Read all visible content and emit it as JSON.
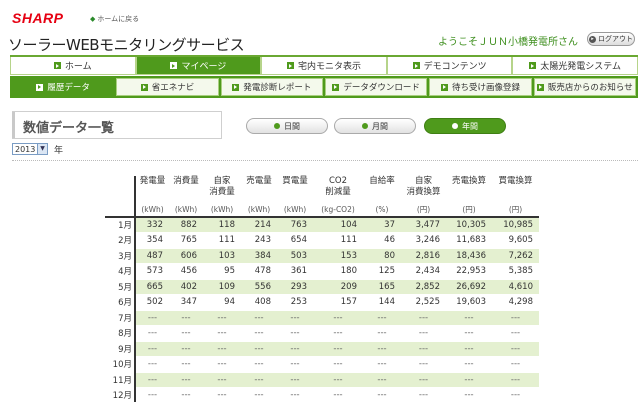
{
  "brand": {
    "logo": "SHARP",
    "home_link": "ホームに戻る"
  },
  "app_title": "ソーラーWEBモニタリングサービス",
  "welcome": "ようこそＪＵＮ小橋発電所さん",
  "logout_label": "ログアウト",
  "nav_main": [
    {
      "label": "ホーム",
      "active": false
    },
    {
      "label": "マイページ",
      "active": true
    },
    {
      "label": "宅内モニタ表示",
      "active": false
    },
    {
      "label": "デモコンテンツ",
      "active": false
    },
    {
      "label": "太陽光発電システム",
      "active": false
    }
  ],
  "nav_sub": [
    {
      "label": "履歴データ",
      "active": true
    },
    {
      "label": "省エネナビ",
      "active": false
    },
    {
      "label": "発電診断レポート",
      "active": false
    },
    {
      "label": "データダウンロード",
      "active": false
    },
    {
      "label": "待ち受け画像登録",
      "active": false
    },
    {
      "label": "販売店からのお知らせ",
      "active": false
    }
  ],
  "section_title": "数値データ一覧",
  "period_tabs": [
    {
      "label": "日間",
      "active": false
    },
    {
      "label": "月間",
      "active": false
    },
    {
      "label": "年間",
      "active": true
    }
  ],
  "year_select": {
    "value": "2013",
    "unit": "年"
  },
  "table": {
    "headers": [
      {
        "label": "発電量",
        "unit": "(kWh)"
      },
      {
        "label": "消費量",
        "unit": "(kWh)"
      },
      {
        "label": "自家\n消費量",
        "unit": "(kWh)"
      },
      {
        "label": "売電量",
        "unit": "(kWh)"
      },
      {
        "label": "買電量",
        "unit": "(kWh)"
      },
      {
        "label": "CO2\n削減量",
        "unit": "(kg-CO2)"
      },
      {
        "label": "自給率",
        "unit": "(%)"
      },
      {
        "label": "自家\n消費換算",
        "unit": "(円)"
      },
      {
        "label": "売電換算",
        "unit": "(円)"
      },
      {
        "label": "買電換算",
        "unit": "(円)"
      }
    ],
    "rows": [
      {
        "month": "1月",
        "values": [
          "332",
          "882",
          "118",
          "214",
          "763",
          "104",
          "37",
          "3,477",
          "10,305",
          "10,985"
        ]
      },
      {
        "month": "2月",
        "values": [
          "354",
          "765",
          "111",
          "243",
          "654",
          "111",
          "46",
          "3,246",
          "11,683",
          "9,605"
        ]
      },
      {
        "month": "3月",
        "values": [
          "487",
          "606",
          "103",
          "384",
          "503",
          "153",
          "80",
          "2,816",
          "18,436",
          "7,262"
        ]
      },
      {
        "month": "4月",
        "values": [
          "573",
          "456",
          "95",
          "478",
          "361",
          "180",
          "125",
          "2,434",
          "22,953",
          "5,385"
        ]
      },
      {
        "month": "5月",
        "values": [
          "665",
          "402",
          "109",
          "556",
          "293",
          "209",
          "165",
          "2,852",
          "26,692",
          "4,610"
        ]
      },
      {
        "month": "6月",
        "values": [
          "502",
          "347",
          "94",
          "408",
          "253",
          "157",
          "144",
          "2,525",
          "19,603",
          "4,298"
        ]
      },
      {
        "month": "7月",
        "values": [
          "---",
          "---",
          "---",
          "---",
          "---",
          "---",
          "---",
          "---",
          "---",
          "---"
        ]
      },
      {
        "month": "8月",
        "values": [
          "---",
          "---",
          "---",
          "---",
          "---",
          "---",
          "---",
          "---",
          "---",
          "---"
        ]
      },
      {
        "month": "9月",
        "values": [
          "---",
          "---",
          "---",
          "---",
          "---",
          "---",
          "---",
          "---",
          "---",
          "---"
        ]
      },
      {
        "month": "10月",
        "values": [
          "---",
          "---",
          "---",
          "---",
          "---",
          "---",
          "---",
          "---",
          "---",
          "---"
        ]
      },
      {
        "month": "11月",
        "values": [
          "---",
          "---",
          "---",
          "---",
          "---",
          "---",
          "---",
          "---",
          "---",
          "---"
        ]
      },
      {
        "month": "12月",
        "values": [
          "---",
          "---",
          "---",
          "---",
          "---",
          "---",
          "---",
          "---",
          "---",
          "---"
        ]
      }
    ]
  },
  "colors": {
    "brand_red": "#e60012",
    "accent_green": "#4f9a1c",
    "row_stripe": "#e4f0d0",
    "welcome_green": "#3e8f1e"
  }
}
